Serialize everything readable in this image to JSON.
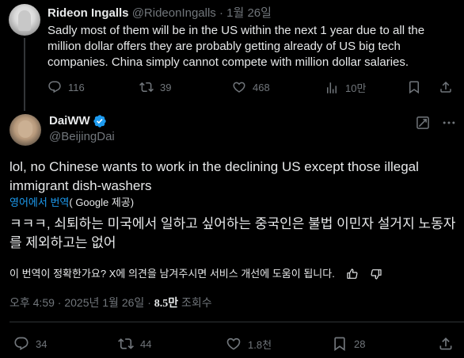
{
  "reply_tweet": {
    "author_name": "Rideon Ingalls",
    "author_handle": "@RideonIngalls",
    "separator": "·",
    "date": "1월 26일",
    "text": "Sadly most of them will be in the US within the next 1 year due to all the million dollar offers they are probably getting already of US big tech companies. China simply cannot compete with million dollar salaries.",
    "actions": {
      "replies": "116",
      "retweets": "39",
      "likes": "468",
      "views": "10만"
    }
  },
  "main_tweet": {
    "author_name": "DaiWW",
    "author_handle": "@BeijingDai",
    "verified_color": "#1d9bf0",
    "text": "lol, no Chinese wants to work in the declining US except those illegal immigrant dish-washers",
    "translate_link": "영어에서 번역",
    "translate_provider": "( Google 제공)",
    "translation": "ㅋㅋㅋ, 쇠퇴하는 미국에서 일하고 싶어하는 중국인은 불법 이민자 설거지 노동자를 제외하고는 없어",
    "feedback_prompt": "이 번역이 정확한가요? X에 의견을 남겨주시면 서비스 개선에 도움이 됩니다.",
    "time": "오후 4:59",
    "date": "2025년 1월 26일",
    "separator": "·",
    "view_count": "8.5만",
    "view_label": "조회수",
    "actions": {
      "replies": "34",
      "retweets": "44",
      "likes": "1.8천",
      "bookmarks": "28"
    }
  },
  "colors": {
    "background": "#000000",
    "text": "#e7e9ea",
    "muted": "#71767b",
    "accent": "#1d9bf0",
    "divider": "#2f3336"
  }
}
